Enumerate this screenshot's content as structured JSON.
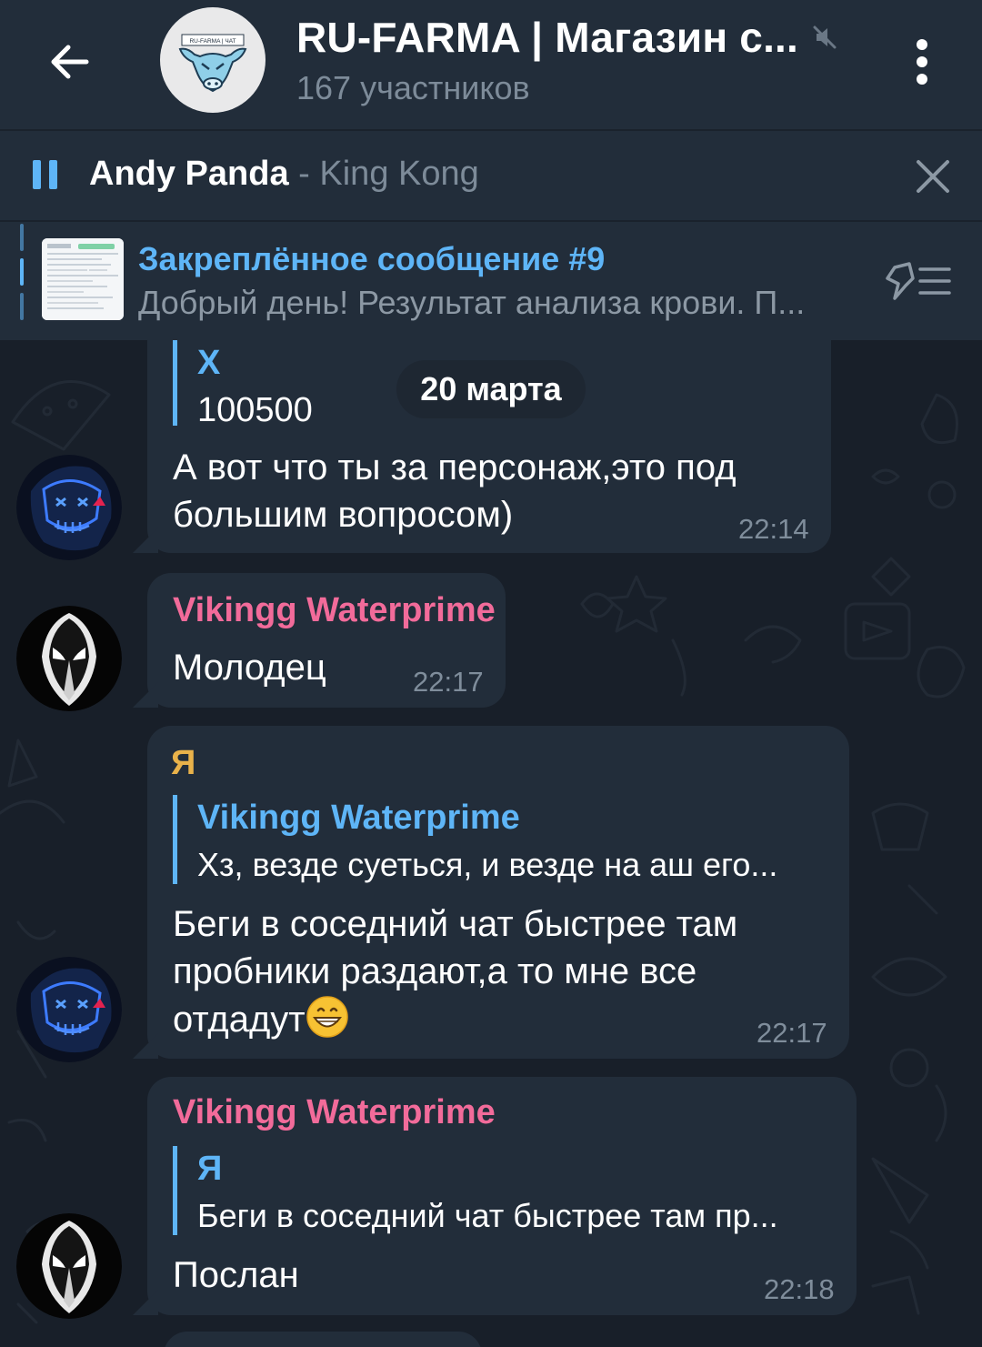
{
  "header": {
    "title": "RU-FARMA | Магазин с...",
    "subtitle": "167 участников",
    "avatar_text": "RU-FARMA | ЧАТ"
  },
  "player": {
    "artist": "Andy Panda",
    "separator": " - ",
    "title": "King Kong"
  },
  "pinned": {
    "title": "Закреплённое сообщение #9",
    "text": "Добрый день! Результат анализа крови. П..."
  },
  "date_separator": "20 марта",
  "messages": [
    {
      "quote_name": "X",
      "quote_text": "100500",
      "lines": [
        "А вот что ты за персонаж,это под",
        "большим вопросом)"
      ],
      "time": "22:14"
    },
    {
      "sender": "Vikingg Waterprime",
      "text": "Молодец",
      "time": "22:17"
    },
    {
      "sender": "Я",
      "quote_name": "Vikingg Waterprime",
      "quote_text": "Хз, везде суеться, и везде на аш его...",
      "lines": [
        "Беги в соседний чат быстрее там",
        "пробники раздают,а то мне все",
        "отдадут"
      ],
      "emoji": "grinning-face",
      "time": "22:17"
    },
    {
      "sender": "Vikingg Waterprime",
      "quote_name": "Я",
      "quote_text": "Беги в соседний чат быстрее там пр...",
      "text": "Послан",
      "time": "22:18"
    }
  ],
  "colors": {
    "background": "#181f29",
    "panel": "#222d3a",
    "accent": "#5eb5f7",
    "sender_pink": "#f26b9a",
    "sender_gold": "#e9b24a",
    "muted_text": "#7d8b99"
  },
  "icons": [
    "back-arrow-icon",
    "muted-icon",
    "more-vertical-icon",
    "pause-icon",
    "close-icon",
    "pinned-list-icon"
  ]
}
